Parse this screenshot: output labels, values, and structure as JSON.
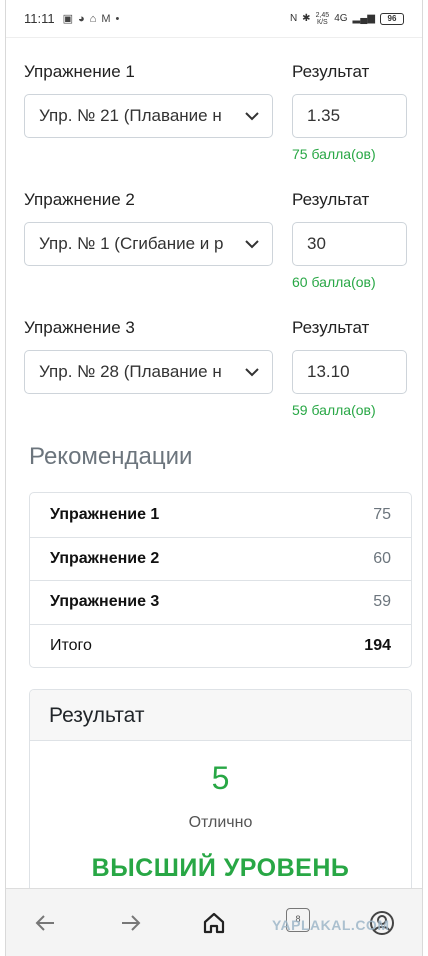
{
  "status_bar": {
    "time": "11:11",
    "network_speed_top": "2,45",
    "network_speed_bottom": "К/S",
    "signal": "4G",
    "battery": "96"
  },
  "exercises": [
    {
      "label": "Упражнение 1",
      "result_label": "Результат",
      "selected": "Упр. № 21 (Плавание н",
      "value": "1.35",
      "points": "75 балла(ов)"
    },
    {
      "label": "Упражнение 2",
      "result_label": "Результат",
      "selected": "Упр. № 1 (Сгибание и р",
      "value": "30",
      "points": "60 балла(ов)"
    },
    {
      "label": "Упражнение 3",
      "result_label": "Результат",
      "selected": "Упр. № 28 (Плавание н",
      "value": "13.10",
      "points": "59 балла(ов)"
    }
  ],
  "recommendations": {
    "title": "Рекомендации",
    "rows": [
      {
        "name": "Упражнение 1",
        "value": "75"
      },
      {
        "name": "Упражнение 2",
        "value": "60"
      },
      {
        "name": "Упражнение 3",
        "value": "59"
      }
    ],
    "total_label": "Итого",
    "total_value": "194"
  },
  "result": {
    "header": "Результат",
    "grade": "5",
    "grade_text": "Отлично",
    "level": "ВЫСШИЙ УРОВЕНЬ"
  },
  "bottom_nav": {
    "tab_count": "8",
    "icons": [
      "back-arrow-icon",
      "forward-arrow-icon",
      "home-icon",
      "tabs-icon",
      "profile-icon"
    ]
  },
  "watermark": "YAPLAKAL.COM",
  "colors": {
    "success": "#28a745",
    "muted": "#6c757d",
    "border": "#ced4da"
  }
}
